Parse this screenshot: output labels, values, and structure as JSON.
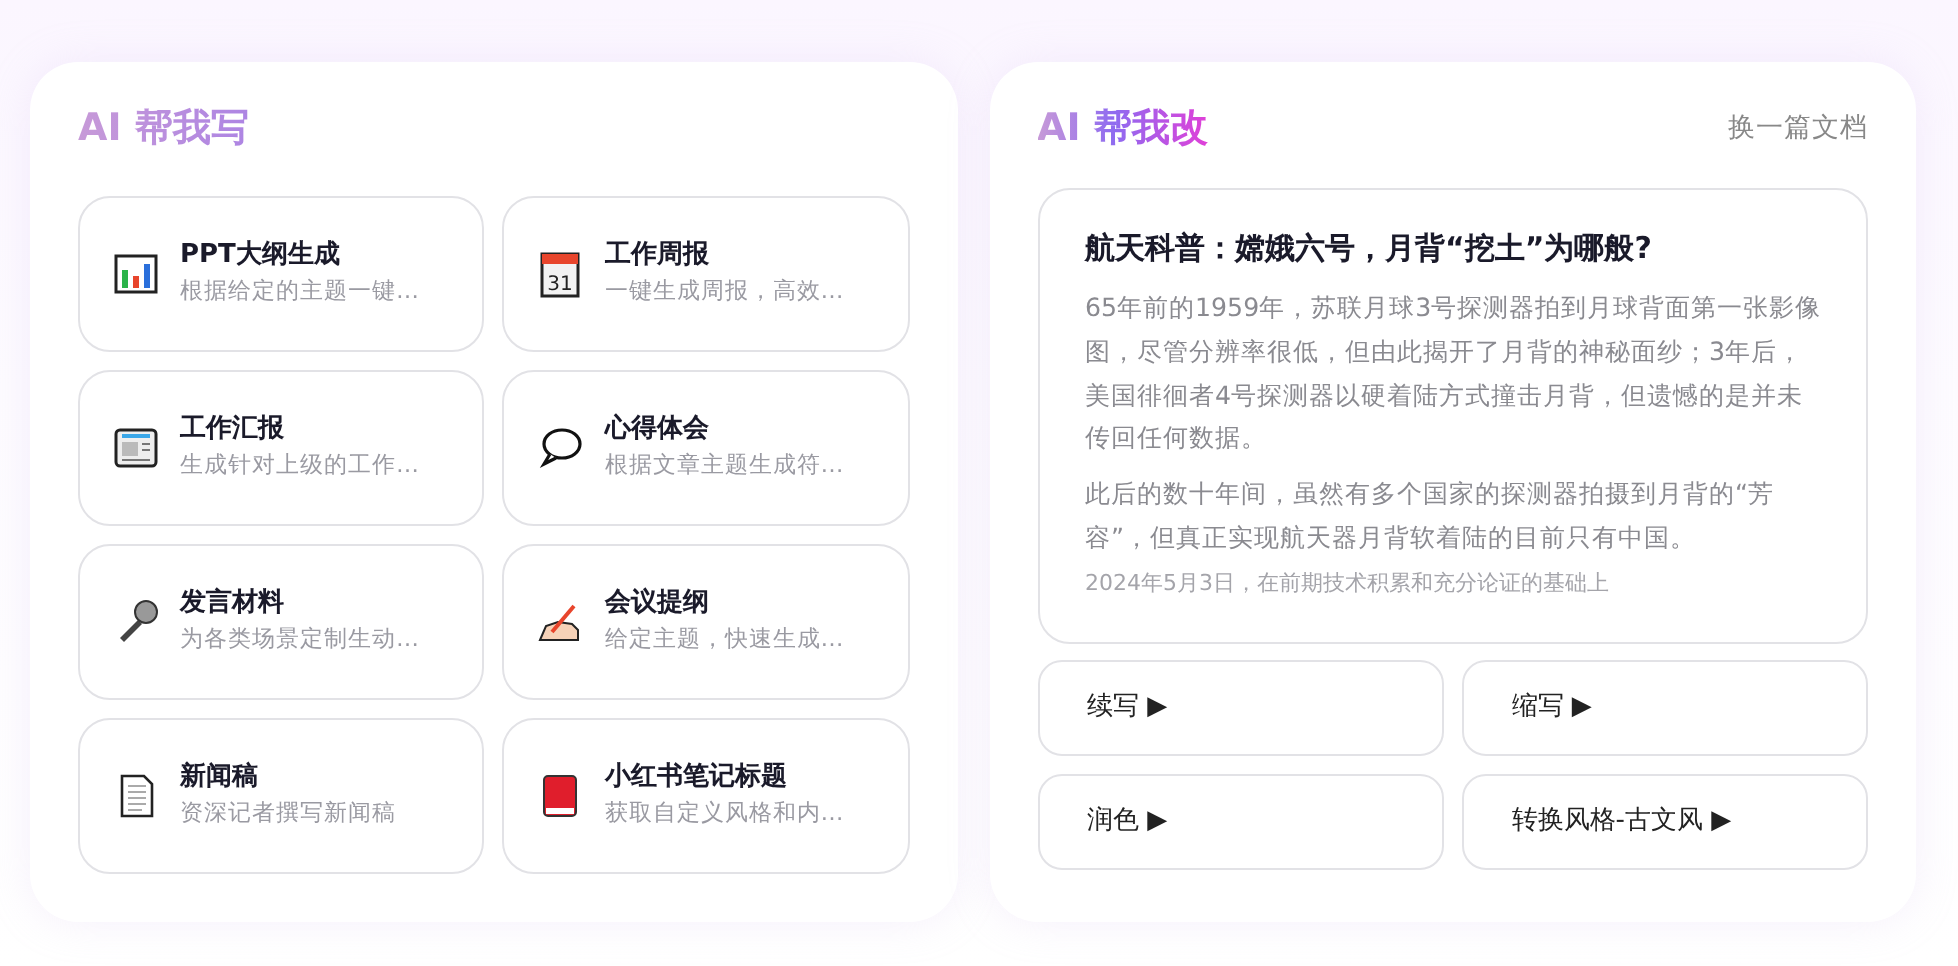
{
  "write_panel": {
    "title": "AI 帮我写",
    "tools": [
      {
        "name": "PPT大纲生成",
        "desc": "根据给定的主题一键…"
      },
      {
        "name": "工作周报",
        "desc": "一键生成周报，高效…",
        "calendar_day": "31"
      },
      {
        "name": "工作汇报",
        "desc": "生成针对上级的工作…"
      },
      {
        "name": "心得体会",
        "desc": "根据文章主题生成符…"
      },
      {
        "name": "发言材料",
        "desc": "为各类场景定制生动…"
      },
      {
        "name": "会议提纲",
        "desc": "给定主题，快速生成…"
      },
      {
        "name": "新闻稿",
        "desc": "资深记者撰写新闻稿"
      },
      {
        "name": "小红书笔记标题",
        "desc": "获取自定义风格和内…"
      }
    ]
  },
  "edit_panel": {
    "title": "AI 帮我改",
    "switch_link": "换一篇文档",
    "document": {
      "title": "航天科普：嫦娥六号，月背“挖土”为哪般?",
      "paragraphs": [
        "65年前的1959年，苏联月球3号探测器拍到月球背面第一张影像图，尽管分辨率很低，但由此揭开了月背的神秘面纱；3年后，美国徘徊者4号探测器以硬着陆方式撞击月背，但遗憾的是并未传回任何数据。",
        "此后的数十年间，虽然有多个国家的探测器拍摄到月背的“芳容”，但真正实现航天器月背软着陆的目前只有中国。",
        "2024年5月3日，在前期技术积累和充分论证的基础上"
      ]
    },
    "actions": [
      "续写 ▶",
      "缩写 ▶",
      "润色 ▶",
      "转换风格-古文风 ▶"
    ]
  }
}
